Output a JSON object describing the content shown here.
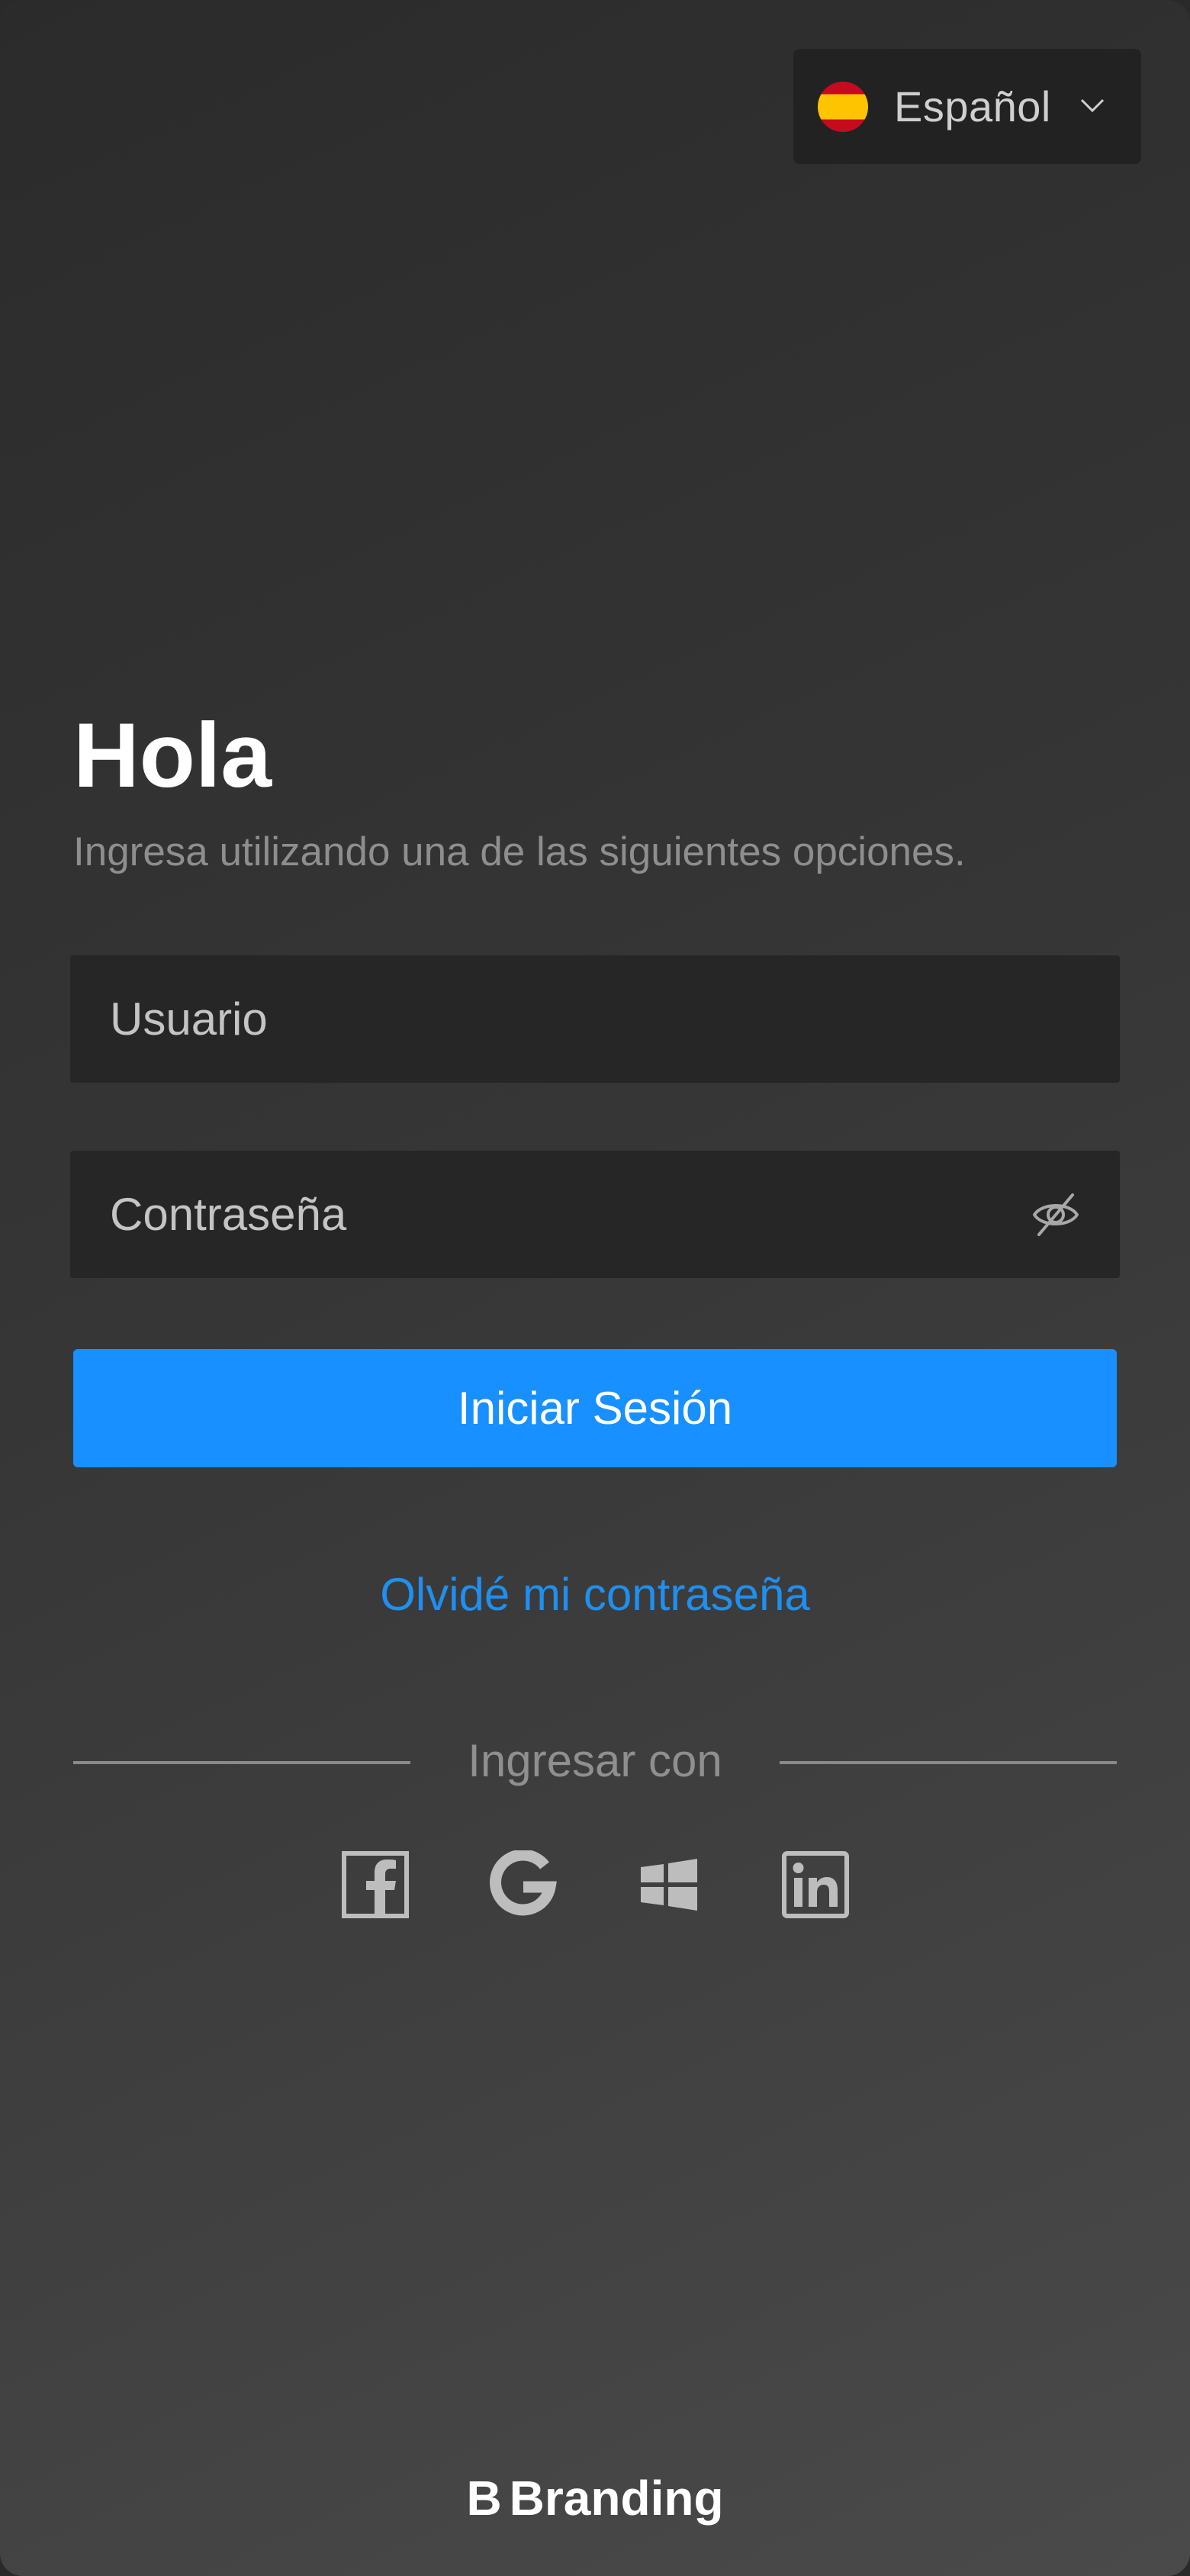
{
  "language": {
    "selected": "Español",
    "flag": "spain-flag"
  },
  "login": {
    "title": "Hola",
    "subtitle": "Ingresa utilizando una de las siguientes opciones.",
    "username_placeholder": "Usuario",
    "password_placeholder": "Contraseña",
    "submit_label": "Iniciar Sesión",
    "forgot_label": "Olvidé mi contraseña"
  },
  "social": {
    "divider_label": "Ingresar con",
    "providers": [
      "facebook-icon",
      "google-icon",
      "windows-icon",
      "linkedin-icon"
    ]
  },
  "brand": {
    "mark": "B",
    "name": "Branding"
  },
  "colors": {
    "accent": "#1890ff",
    "link": "#1f8ff0",
    "field_bg": "#262626",
    "icon": "#bdbdbd"
  }
}
